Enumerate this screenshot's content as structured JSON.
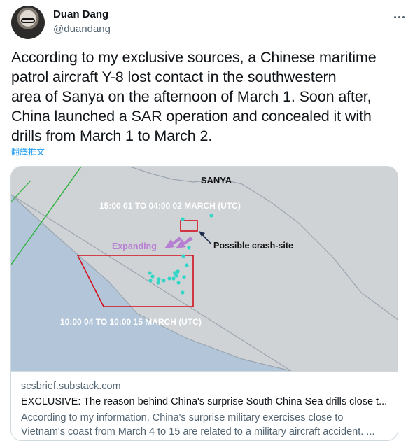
{
  "author": {
    "name": "Duan Dang",
    "handle": "@duandang"
  },
  "more_label": "More",
  "tweet": {
    "text": "According to my exclusive sources, a Chinese maritime\npatrol aircraft Y-8 lost contact in the southwestern\narea of Sanya on the afternoon of March 1. Soon after,\nChina launched a SAR operation and concealed it with\ndrills from March 1 to March 2."
  },
  "translate_label": "翻譯推文",
  "map": {
    "city": "SANYA",
    "period_1": "15:00 01 TO 04:00 02 MARCH (UTC)",
    "period_2": "10:00 04 TO 10:00 15 MARCH (UTC)",
    "expanding": "Expanding",
    "crash_site": "Possible crash-site",
    "colors": {
      "land": "#d0d3d6",
      "sea": "#b3c5d9",
      "zone": "#d1101c",
      "boundary": "#2fb33f",
      "marker": "#33d6c6",
      "arrow": "#b77fd1"
    }
  },
  "link_card": {
    "domain": "scsbrief.substack.com",
    "title": "EXCLUSIVE: The reason behind China's surprise South China Sea drills close t...",
    "description": "According to my information, China's surprise military exercises close to\nVietnam's coast from March 4 to 15 are related to a military aircraft accident. ..."
  }
}
